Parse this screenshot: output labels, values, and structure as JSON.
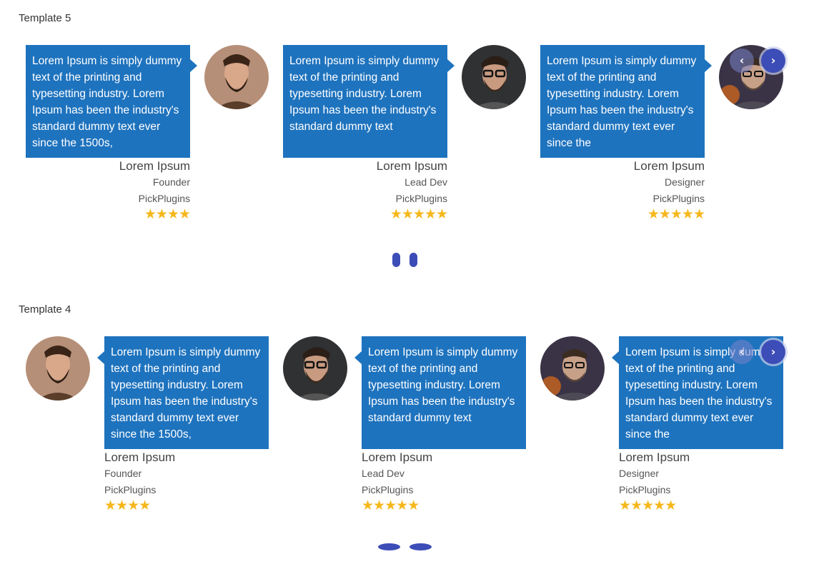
{
  "template5": {
    "title": "Template 5",
    "cards": [
      {
        "text": "Lorem Ipsum is simply dummy text of the printing and typesetting industry. Lorem Ipsum has been the industry's standard dummy text ever since the 1500s,",
        "name": "Lorem Ipsum",
        "role": "Founder",
        "company": "PickPlugins",
        "stars": "★★★★",
        "rating": 4,
        "avatar": "bearded-man-photo"
      },
      {
        "text": "Lorem Ipsum is simply dummy text of the printing and typesetting industry. Lorem Ipsum has been the industry's standard dummy text",
        "name": "Lorem Ipsum",
        "role": "Lead Dev",
        "company": "PickPlugins",
        "stars": "★★★★★",
        "rating": 5,
        "avatar": "glasses-man-photo"
      },
      {
        "text": "Lorem Ipsum is simply dummy text of the printing and typesetting industry. Lorem Ipsum has been the industry's standard dummy text ever since the",
        "name": "Lorem Ipsum",
        "role": "Designer",
        "company": "PickPlugins",
        "stars": "★★★★★",
        "rating": 5,
        "avatar": "suit-man-photo"
      }
    ],
    "prev_icon": "chevron-left-icon",
    "next_icon": "chevron-right-icon",
    "prev_glyph": "‹",
    "next_glyph": "›"
  },
  "template4": {
    "title": "Template 4",
    "cards": [
      {
        "text": "Lorem Ipsum is simply dummy text of the printing and typesetting industry. Lorem Ipsum has been the industry's standard dummy text ever since the 1500s,",
        "name": "Lorem Ipsum",
        "role": "Founder",
        "company": "PickPlugins",
        "stars": "★★★★",
        "rating": 4,
        "avatar": "bearded-man-photo"
      },
      {
        "text": "Lorem Ipsum is simply dummy text of the printing and typesetting industry. Lorem Ipsum has been the industry's standard dummy text",
        "name": "Lorem Ipsum",
        "role": "Lead Dev",
        "company": "PickPlugins",
        "stars": "★★★★★",
        "rating": 5,
        "avatar": "glasses-man-photo"
      },
      {
        "text": "Lorem Ipsum is simply dummy text of the printing and typesetting industry. Lorem Ipsum has been the industry's standard dummy text ever since the",
        "name": "Lorem Ipsum",
        "role": "Designer",
        "company": "PickPlugins",
        "stars": "★★★★★",
        "rating": 5,
        "avatar": "suit-man-photo"
      }
    ],
    "prev_glyph": "‹",
    "next_glyph": "›"
  },
  "colors": {
    "bubble": "#1e73be",
    "accent": "#3d4db7",
    "star": "#f5b81c"
  }
}
